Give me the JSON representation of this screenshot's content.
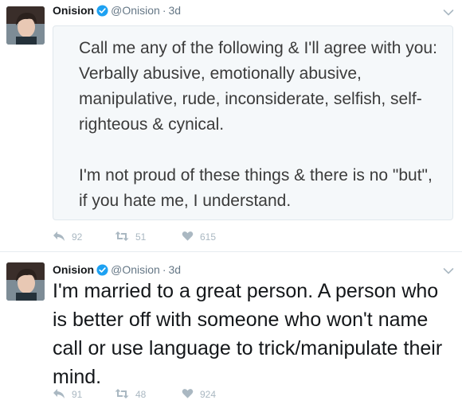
{
  "colors": {
    "verified": "#1da1f2",
    "action_icons": "#aab8c2",
    "meta_text": "#657786",
    "quote_bg": "#f5f8fa"
  },
  "tweets": [
    {
      "name": "Onision",
      "handle": "@Onision",
      "separator": "·",
      "time": "3d",
      "quote_text": "Call me any of the following & I'll agree with you: Verbally abusive, emotionally abusive, manipulative, rude, inconsiderate, selfish, self-righteous & cynical.\n\nI'm not proud of these things & there is no \"but\", if you hate me, I understand.",
      "actions": {
        "replies": "92",
        "retweets": "51",
        "likes": "615"
      }
    },
    {
      "name": "Onision",
      "handle": "@Onision",
      "separator": "·",
      "time": "3d",
      "text": "I'm married to a great person. A person who is better off with someone who won't name call or use language to trick/manipulate their mind.",
      "actions": {
        "replies": "91",
        "retweets": "48",
        "likes": "924"
      }
    }
  ]
}
